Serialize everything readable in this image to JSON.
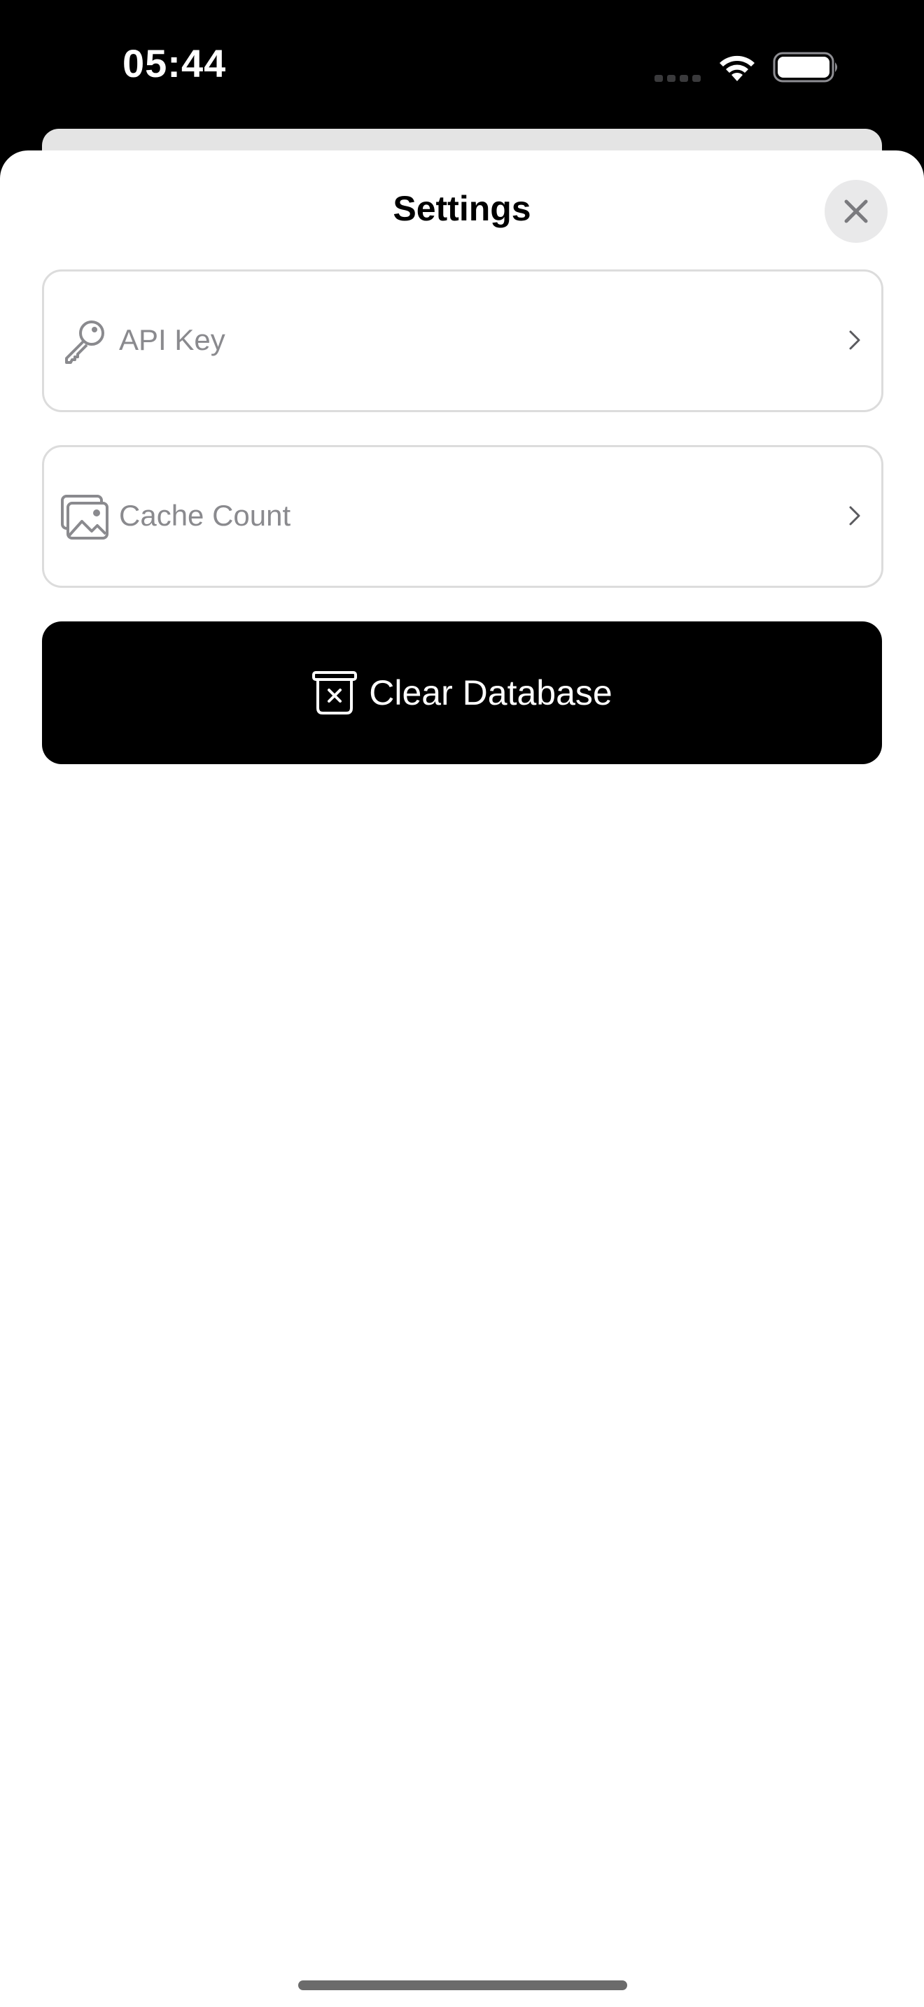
{
  "status_bar": {
    "time": "05:44",
    "icons": [
      "signal-dots-icon",
      "wifi-icon",
      "battery-icon"
    ]
  },
  "sheet": {
    "title": "Settings",
    "close_icon": "close-icon"
  },
  "settings_rows": [
    {
      "label": "API Key",
      "icon": "key-icon",
      "chevron": "chevron-right-icon"
    },
    {
      "label": "Cache Count",
      "icon": "photo-stack-icon",
      "chevron": "chevron-right-icon"
    }
  ],
  "clear_button": {
    "label": "Clear Database",
    "icon": "trash-x-icon"
  },
  "colors": {
    "background": "#000000",
    "sheet": "#ffffff",
    "row_border": "#dcdcdc",
    "row_text": "#8a8a8e",
    "button_background": "#000000",
    "button_text": "#ffffff"
  }
}
